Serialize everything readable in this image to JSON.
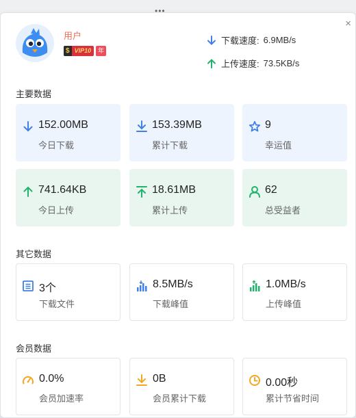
{
  "window": {
    "more_glyph": "•••",
    "close_glyph": "×"
  },
  "user": {
    "name": "用户",
    "vip_s": "$",
    "vip_text": "VIP10",
    "year_badge": "年"
  },
  "speed": {
    "download_label": "下载速度:",
    "download_value": "6.9MB/s",
    "upload_label": "上传速度:",
    "upload_value": "73.5KB/s"
  },
  "sections": {
    "main": "主要数据",
    "other": "其它数据",
    "member": "会员数据"
  },
  "main_cards": [
    {
      "value": "152.00MB",
      "label": "今日下载",
      "icon": "download-arrow-icon"
    },
    {
      "value": "153.39MB",
      "label": "累计下载",
      "icon": "download-tray-icon"
    },
    {
      "value": "9",
      "label": "幸运值",
      "icon": "star-icon"
    },
    {
      "value": "741.64KB",
      "label": "今日上传",
      "icon": "upload-arrow-icon"
    },
    {
      "value": "18.61MB",
      "label": "累计上传",
      "icon": "upload-bar-icon"
    },
    {
      "value": "62",
      "label": "总受益者",
      "icon": "user-icon"
    }
  ],
  "other_cards": [
    {
      "value": "3个",
      "label": "下载文件",
      "icon": "file-icon"
    },
    {
      "value": "8.5MB/s",
      "label": "下载峰值",
      "icon": "download-peak-icon"
    },
    {
      "value": "1.0MB/s",
      "label": "上传峰值",
      "icon": "upload-peak-icon"
    }
  ],
  "member_cards": [
    {
      "value": "0.0%",
      "label": "会员加速率",
      "icon": "speedometer-icon"
    },
    {
      "value": "0B",
      "label": "会员累计下载",
      "icon": "download-tray-icon"
    },
    {
      "value": "0.00秒",
      "label": "累计节省时间",
      "icon": "clock-icon"
    }
  ],
  "colors": {
    "blue": "#3f7fe8",
    "green": "#1fb36b",
    "orange": "#f5a623",
    "name": "#f06e57"
  }
}
